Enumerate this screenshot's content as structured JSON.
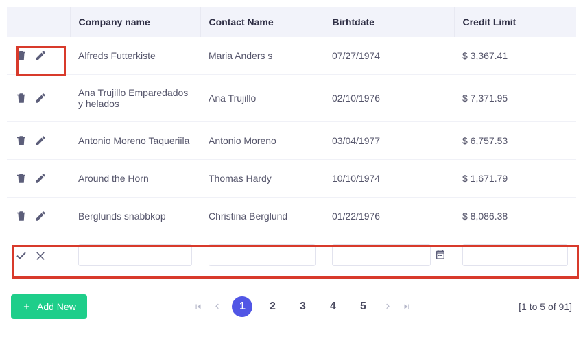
{
  "columns": {
    "actions": "",
    "company": "Company name",
    "contact": "Contact Name",
    "birth": "Birhtdate",
    "credit": "Credit Limit"
  },
  "rows": [
    {
      "company": "Alfreds Futterkiste",
      "contact": "Maria Anders s",
      "birth": "07/27/1974",
      "credit": "$ 3,367.41"
    },
    {
      "company": "Ana Trujillo Emparedados y helados",
      "contact": "Ana Trujillo",
      "birth": "02/10/1976",
      "credit": "$ 7,371.95"
    },
    {
      "company": "Antonio Moreno Taqueriila",
      "contact": "Antonio Moreno",
      "birth": "03/04/1977",
      "credit": "$ 6,757.53"
    },
    {
      "company": "Around the Horn",
      "contact": "Thomas Hardy",
      "birth": "10/10/1974",
      "credit": "$ 1,671.79"
    },
    {
      "company": "Berglunds snabbkop",
      "contact": "Christina Berglund",
      "birth": "01/22/1976",
      "credit": "$ 8,086.38"
    }
  ],
  "footer": {
    "add_label": "Add New",
    "pages": [
      "1",
      "2",
      "3",
      "4",
      "5"
    ],
    "active_page": "1",
    "range": "[1 to 5 of 91]"
  }
}
